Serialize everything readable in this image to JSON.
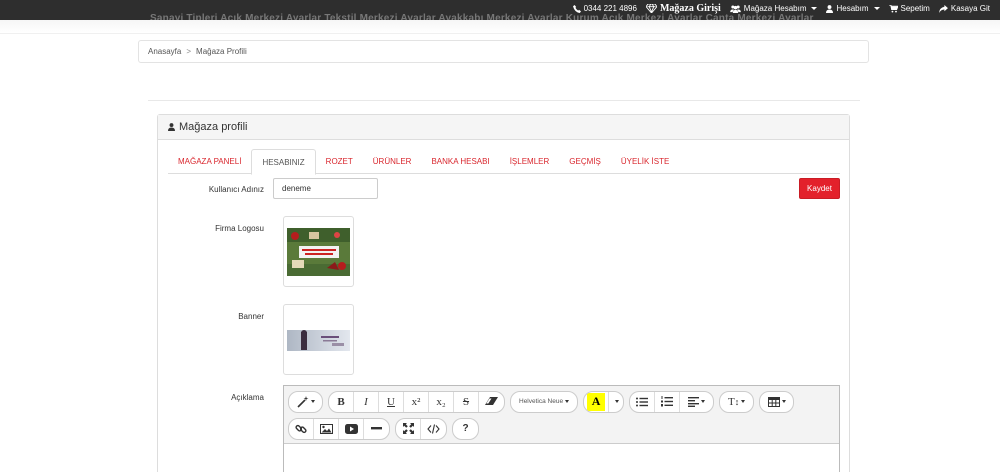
{
  "topbar": {
    "ghost_nav": "Sanayi Tipleri     Açık Merkezi Ayarlar     Tekstil Merkezi Ayarlar     Ayakkabı Merkezi Ayarlar     Kurum Açık Merkezi Ayarlar     Çanta Merkezi Ayarlar",
    "phone": "0344 221 4896",
    "store_login": "Mağaza Girişi",
    "store_account": "Mağaza Hesabım",
    "my_account": "Hesabım",
    "cart": "Sepetim",
    "checkout": "Kasaya Git"
  },
  "breadcrumb": {
    "home": "Anasayfa",
    "separator": ">",
    "current": "Mağaza Profili"
  },
  "panel": {
    "title": "Mağaza profili",
    "tabs": [
      "MAĞAZA PANELİ",
      "HESABINIZ",
      "ROZET",
      "ÜRÜNLER",
      "BANKA HESABI",
      "İŞLEMLER",
      "GEÇMİŞ",
      "ÜYELİK İSTE"
    ],
    "active_tab": "HESABINIZ"
  },
  "form": {
    "username_label": "Kullanıcı Adınız",
    "username_value": "deneme",
    "save_label": "Kaydet",
    "logo_label": "Firma Logosu",
    "banner_label": "Banner",
    "description_label": "Açıklama"
  },
  "editor": {
    "font_name": "Helvetica Neue",
    "bold": "B",
    "italic": "I",
    "underline": "U",
    "superscript": "x²",
    "subscript": "x₂",
    "strikethrough": "S",
    "color_letter": "A",
    "text_height": "T",
    "help": "?"
  },
  "colors": {
    "accent": "#e3212b",
    "tab_link": "#d9272e",
    "topbar": "#2e2e2e",
    "highlight": "#ffff00"
  }
}
